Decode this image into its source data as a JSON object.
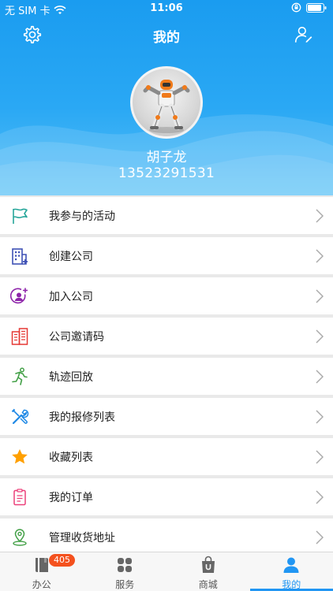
{
  "status": {
    "carrier": "无 SIM 卡",
    "time": "11:06"
  },
  "nav": {
    "title": "我的"
  },
  "user": {
    "name": "胡子龙",
    "phone": "13523291531"
  },
  "menu": [
    {
      "label": "我参与的活动",
      "icon": "flag-icon",
      "color": "#26a69a"
    },
    {
      "label": "创建公司",
      "icon": "building-add-icon",
      "color": "#3f51b5"
    },
    {
      "label": "加入公司",
      "icon": "user-add-icon",
      "color": "#8e24aa"
    },
    {
      "label": "公司邀请码",
      "icon": "office-building-icon",
      "color": "#e53935"
    },
    {
      "label": "轨迹回放",
      "icon": "running-person-icon",
      "color": "#43a047"
    },
    {
      "label": "我的报修列表",
      "icon": "repair-tools-icon",
      "color": "#1e88e5"
    },
    {
      "label": "收藏列表",
      "icon": "star-icon",
      "color": "#ffa000"
    },
    {
      "label": "我的订单",
      "icon": "order-list-icon",
      "color": "#ec407a"
    },
    {
      "label": "管理收货地址",
      "icon": "location-pin-icon",
      "color": "#43a047"
    }
  ],
  "tabs": [
    {
      "label": "办公",
      "icon": "office-book-icon",
      "badge": "405"
    },
    {
      "label": "服务",
      "icon": "service-grid-icon"
    },
    {
      "label": "商城",
      "icon": "shopping-bag-icon"
    },
    {
      "label": "我的",
      "icon": "person-icon",
      "active": true
    }
  ],
  "colors": {
    "header_blue": "#1a9cf0",
    "accent": "#2196f3",
    "badge": "#f4511e"
  }
}
